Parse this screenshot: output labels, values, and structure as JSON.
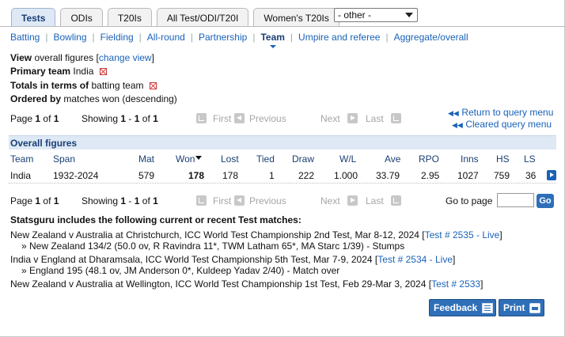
{
  "tabs": [
    {
      "label": "Tests",
      "active": true
    },
    {
      "label": "ODIs",
      "active": false
    },
    {
      "label": "T20Is",
      "active": false
    },
    {
      "label": "All Test/ODI/T20I",
      "active": false
    },
    {
      "label": "Women's T20Is",
      "active": false
    }
  ],
  "other_select": {
    "value": "- other -"
  },
  "subnav": [
    "Batting",
    "Bowling",
    "Fielding",
    "All-round",
    "Partnership",
    "Team",
    "Umpire and referee",
    "Aggregate/overall"
  ],
  "subnav_current": "Team",
  "view": {
    "label": "View",
    "value": "overall figures",
    "open": "[",
    "link": "change view",
    "close": "]"
  },
  "primary_team": {
    "label": "Primary team",
    "value": "India"
  },
  "totals": {
    "label": "Totals in terms of",
    "value": "batting team"
  },
  "ordered": {
    "label": "Ordered by",
    "value": "matches won (descending)"
  },
  "pager": {
    "page_word": "Page",
    "page": "1",
    "of_word": "of",
    "pages": "1",
    "showing_word": "Showing",
    "from": "1",
    "dash": "-",
    "to": "1",
    "of2_word": "of",
    "total": "1",
    "first": "First",
    "previous": "Previous",
    "next": "Next",
    "last": "Last"
  },
  "query_links": {
    "return": "Return to query menu",
    "clear": "Cleared query menu"
  },
  "table": {
    "title": "Overall figures",
    "columns": [
      "Team",
      "Span",
      "Mat",
      "Won",
      "Lost",
      "Tied",
      "Draw",
      "W/L",
      "Ave",
      "RPO",
      "Inns",
      "HS",
      "LS"
    ],
    "rows": [
      [
        "India",
        "1932-2024",
        "579",
        "178",
        "178",
        "1",
        "222",
        "1.000",
        "33.79",
        "2.95",
        "1027",
        "759",
        "36"
      ]
    ]
  },
  "goto": {
    "label": "Go to page",
    "button": "Go",
    "value": ""
  },
  "statsguru": {
    "title": "Statsguru includes the following current or recent Test matches:",
    "matches": [
      {
        "text": "New Zealand v Australia at Christchurch, ICC World Test Championship 2nd Test, Mar 8-12, 2024",
        "open": "[",
        "link": "Test # 2535 - Live",
        "close": "]",
        "detail": "» New Zealand 134/2 (50.0 ov, R Ravindra 11*, TWM Latham 65*, MA Starc 1/39) - Stumps"
      },
      {
        "text": "India v England at Dharamsala, ICC World Test Championship 5th Test, Mar 7-9, 2024",
        "open": "[",
        "link": "Test # 2534 - Live",
        "close": "]",
        "detail": "» England 195 (48.1 ov, JM Anderson 0*, Kuldeep Yadav 2/40) - Match over"
      },
      {
        "text": "New Zealand v Australia at Wellington, ICC World Test Championship 1st Test, Feb 29-Mar 3, 2024",
        "open": "[",
        "link": "Test # 2533",
        "close": "]",
        "detail": ""
      }
    ]
  },
  "buttons": {
    "feedback": "Feedback",
    "print": "Print"
  },
  "colors": {
    "link": "#1a62b8",
    "header_bg": "#dfe9f6",
    "button": "#2f6fb9"
  }
}
